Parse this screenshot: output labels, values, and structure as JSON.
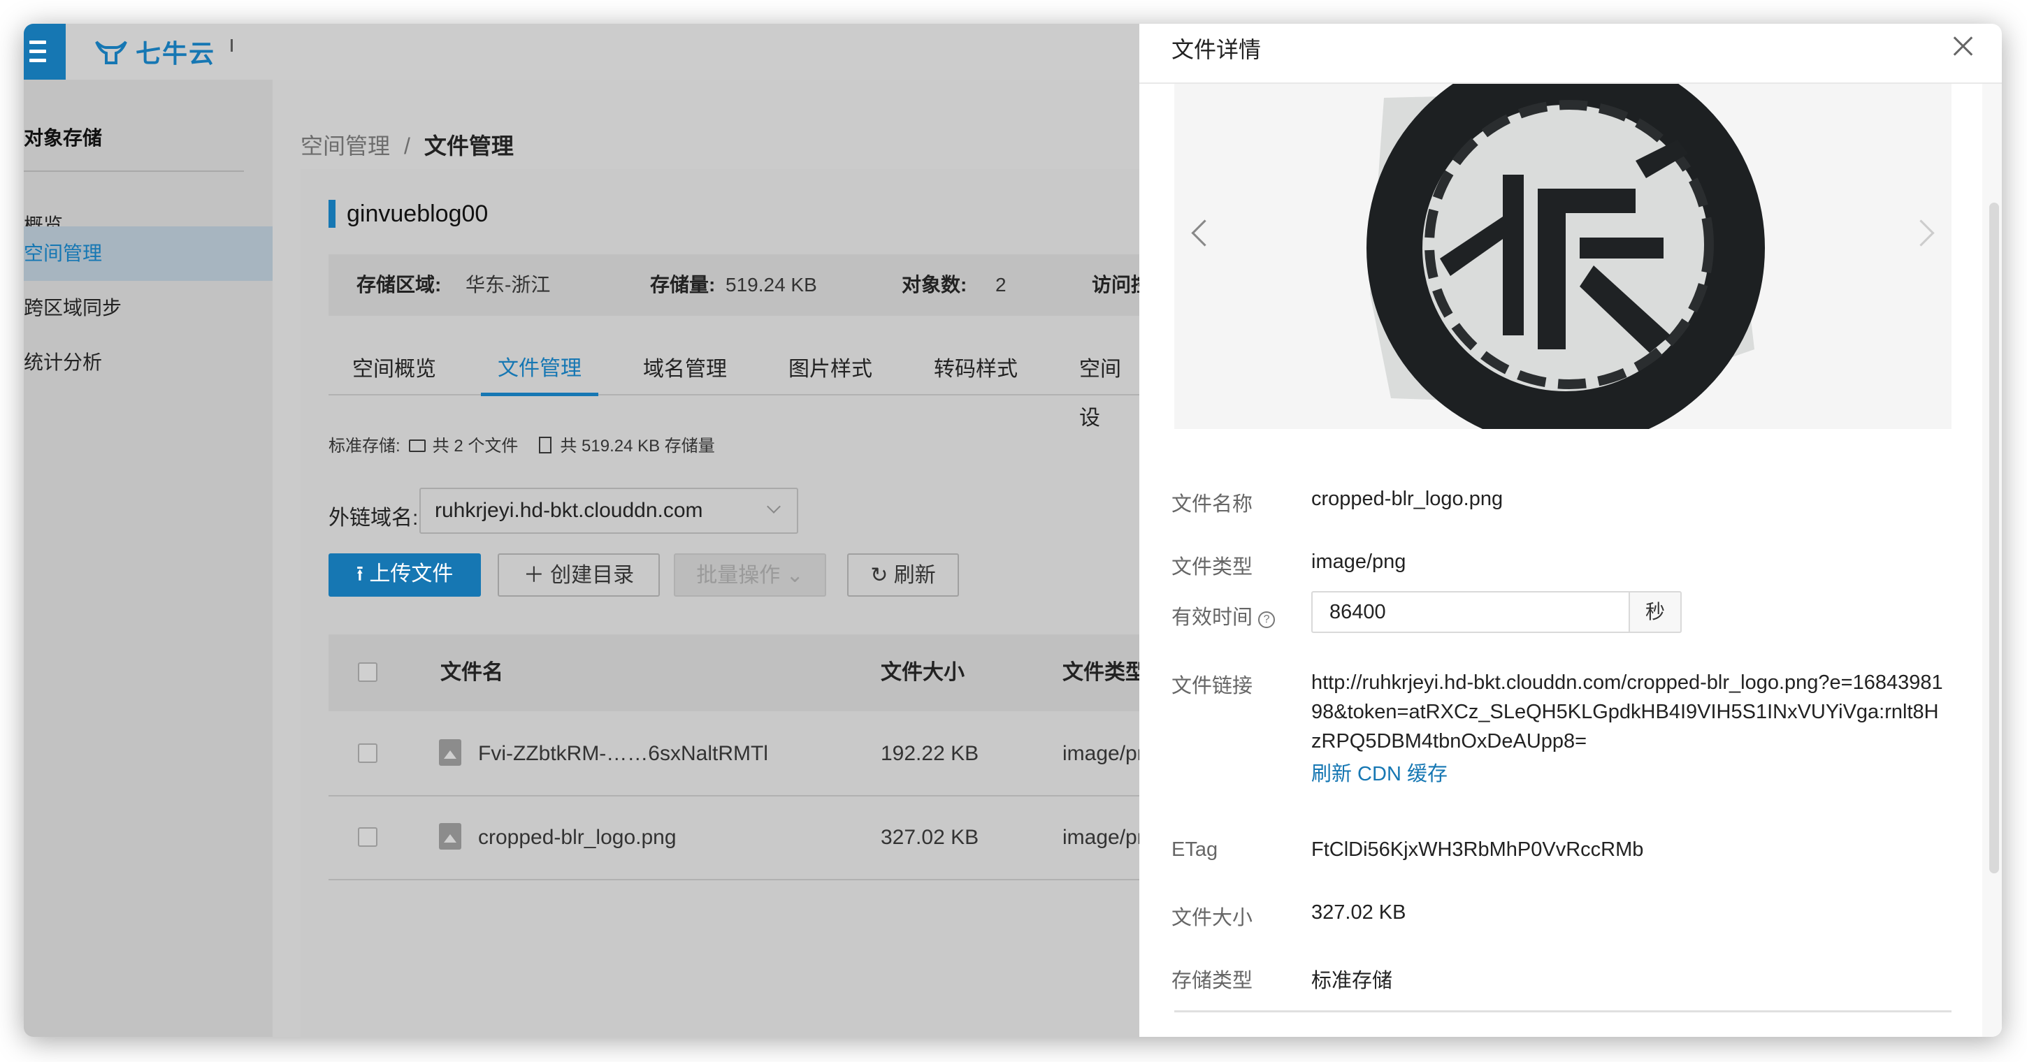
{
  "brand": {
    "name": "七牛云"
  },
  "sidebar": {
    "title": "对象存储",
    "items": [
      {
        "label": "概览"
      },
      {
        "label": "空间管理"
      },
      {
        "label": "跨区域同步"
      },
      {
        "label": "统计分析"
      }
    ]
  },
  "breadcrumb": {
    "parent": "空间管理",
    "separator": "/",
    "current": "文件管理"
  },
  "bucket": {
    "name": "ginvueblog00",
    "region_label": "存储区域:",
    "region_value": "华东-浙江",
    "storage_label": "存储量:",
    "storage_value": "519.24 KB",
    "objects_label": "对象数:",
    "objects_value": "2",
    "access_label": "访问控"
  },
  "tabs": [
    {
      "label": "空间概览"
    },
    {
      "label": "文件管理"
    },
    {
      "label": "域名管理"
    },
    {
      "label": "图片样式"
    },
    {
      "label": "转码样式"
    },
    {
      "label": "空间设"
    }
  ],
  "stats": {
    "prefix": "标准存储:",
    "files": "共 2 个文件",
    "size": "共 519.24 KB 存储量"
  },
  "domain": {
    "label": "外链域名:",
    "value": "ruhkrjeyi.hd-bkt.clouddn.com"
  },
  "toolbar": {
    "upload": "上传文件",
    "mkdir": "创建目录",
    "batch": "批量操作",
    "refresh": "刷新"
  },
  "table": {
    "headers": {
      "name": "文件名",
      "size": "文件大小",
      "type": "文件类型"
    },
    "rows": [
      {
        "name": "Fvi-ZZbtkRM-……6sxNaltRMTl",
        "size": "192.22 KB",
        "type": "image/png"
      },
      {
        "name": "cropped-blr_logo.png",
        "size": "327.02 KB",
        "type": "image/png"
      }
    ]
  },
  "panel": {
    "title": "文件详情",
    "name_label": "文件名称",
    "name_value": "cropped-blr_logo.png",
    "type_label": "文件类型",
    "type_value": "image/png",
    "ttl_label": "有效时间",
    "ttl_value": "86400",
    "ttl_unit": "秒",
    "link_label": "文件链接",
    "link_value": "http://ruhkrjeyi.hd-bkt.clouddn.com/cropped-blr_logo.png?e=1684398198&token=atRXCz_SLeQH5KLGpdkHB4I9VIH5S1INxVUYiVga:rnlt8HzRPQ5DBM4tbnOxDeAUpp8=",
    "link_refresh": "刷新 CDN 缓存",
    "etag_label": "ETag",
    "etag_value": "FtClDi56KjxWH3RbMhP0VvRccRMb",
    "size_label": "文件大小",
    "size_value": "327.02 KB",
    "storage_label": "存储类型",
    "storage_value": "标准存储"
  },
  "colors": {
    "accent": "#1677b3",
    "overlay": "#cbcbcb"
  }
}
